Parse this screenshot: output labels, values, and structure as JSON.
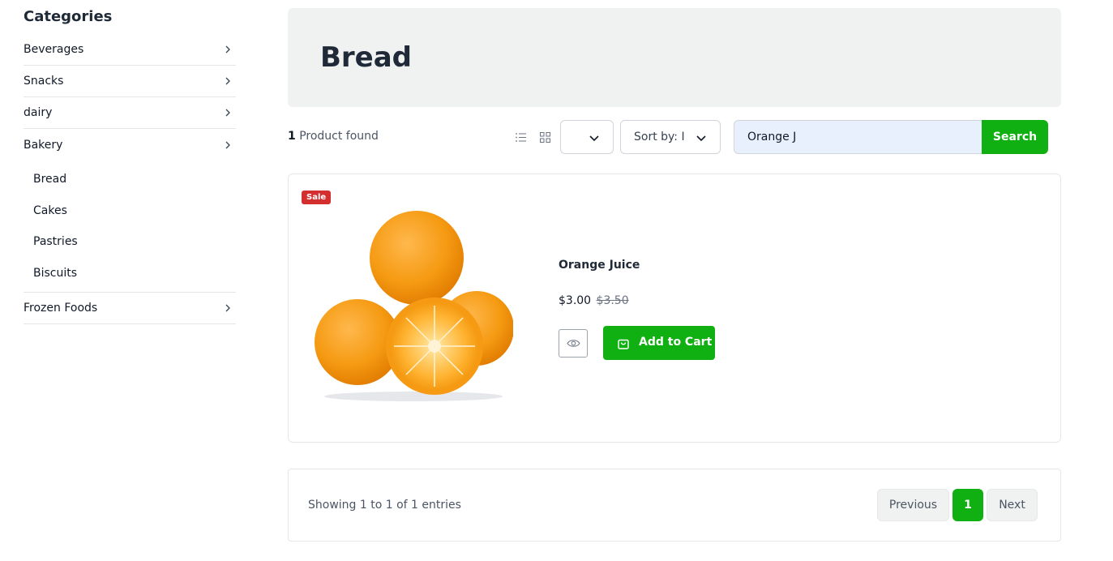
{
  "sidebar": {
    "title": "Categories",
    "categories": [
      {
        "label": "Beverages"
      },
      {
        "label": "Snacks"
      },
      {
        "label": "dairy"
      },
      {
        "label": "Bakery",
        "subcategories": [
          "Bread",
          "Cakes",
          "Pastries",
          "Biscuits"
        ]
      },
      {
        "label": "Frozen Foods"
      }
    ]
  },
  "hero": {
    "title": "Bread"
  },
  "toolbar": {
    "count_number": "1",
    "count_label": "Product found",
    "page_size_value": "",
    "sort_label": "Sort by: I",
    "search_value": "Orange J",
    "search_button": "Search"
  },
  "product": {
    "badge": "Sale",
    "name": "Orange Juice",
    "price": "$3.00",
    "old_price": "$3.50",
    "add_to_cart": "Add to Cart"
  },
  "pagination": {
    "summary": "Showing 1 to 1 of 1 entries",
    "previous": "Previous",
    "current_page": "1",
    "next": "Next"
  },
  "colors": {
    "accent": "#10b012",
    "sale_badge": "#d32f2f",
    "hero_bg": "#f0f1f1"
  }
}
